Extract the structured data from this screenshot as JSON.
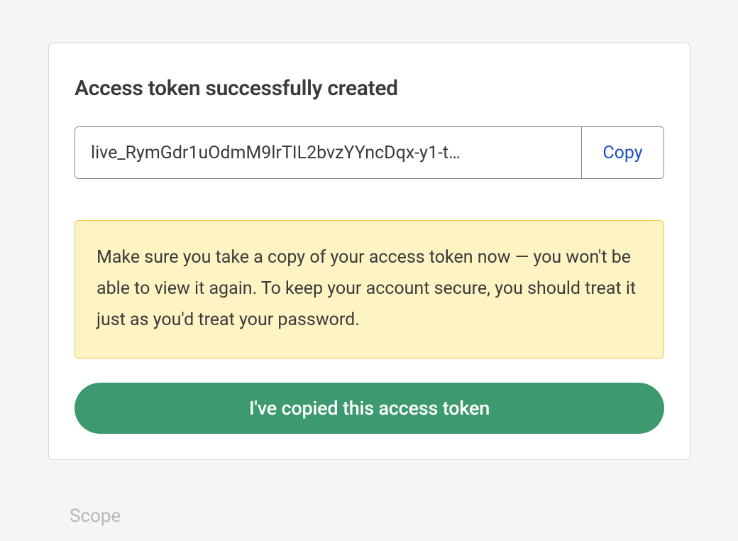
{
  "background": {
    "scope_label": "Scope"
  },
  "modal": {
    "title": "Access token successfully created",
    "token_value": "live_RymGdr1uOdmM9lrTIL2bvzYYncDqx-y1-t…",
    "copy_label": "Copy",
    "warning_text": "Make sure you take a copy of your access token now — you won't be able to view it again. To keep your account secure, you should treat it just as you'd treat your password.",
    "confirm_label": "I've copied this access token"
  }
}
